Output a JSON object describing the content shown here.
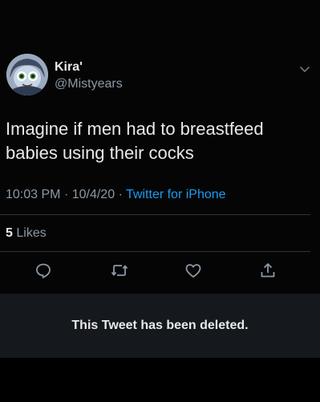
{
  "tweet": {
    "author": {
      "name": "Kira'",
      "handle": "@Mistyears",
      "avatar_icon": "cartoon-avatar"
    },
    "text": "Imagine if men had to breastfeed babies using their cocks",
    "time": "10:03 PM",
    "date": "10/4/20",
    "separator": "·",
    "source": "Twitter for iPhone",
    "likes": {
      "count": "5",
      "label": "Likes"
    },
    "actions": [
      {
        "name": "reply",
        "icon": "comment-icon"
      },
      {
        "name": "retweet",
        "icon": "retweet-icon"
      },
      {
        "name": "like",
        "icon": "heart-icon"
      },
      {
        "name": "share",
        "icon": "share-icon"
      }
    ]
  },
  "deleted_notice": {
    "text": "This Tweet has been deleted."
  },
  "colors": {
    "background": "#000000",
    "text_primary": "#e7e9ea",
    "text_secondary": "#8b98a5",
    "link": "#1d9bf0",
    "divider": "#2f3336",
    "notice_background": "#15181c"
  }
}
